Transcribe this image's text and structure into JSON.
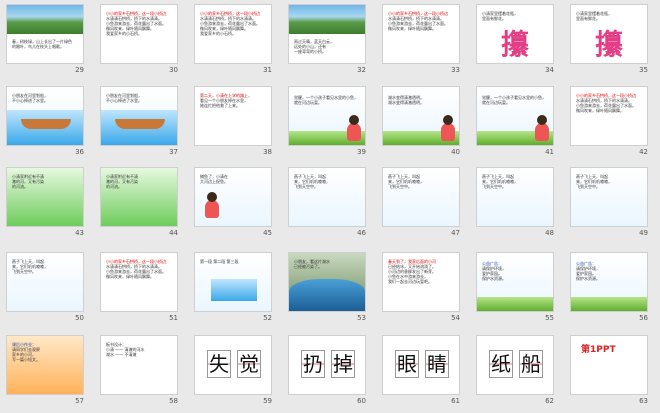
{
  "slides": [
    {
      "number": "29",
      "kind": "photo-text",
      "lines": [
        "春，树枝绿，山上长出了一片绿色",
        "的嫩叶，鸟儿在枝头上唱歌。"
      ]
    },
    {
      "number": "30",
      "kind": "text",
      "lines": [
        "小小的家乡石拱桥，这一段小桥边",
        "水清清石拱桥，桥下的水清清。",
        "小鱼游来游去，荷花露出了水面。",
        "微风吹来，绿叶随风飘舞。",
        "我爱家乡的小石桥。"
      ]
    },
    {
      "number": "31",
      "kind": "text",
      "lines": [
        "小小的家乡石拱桥，这一段小桥边",
        "水清清石拱桥，桥下的水清清。",
        "小鱼游来游去，荷花露出了水面。",
        "微风吹来，绿叶随风飘舞。",
        "我爱家乡的小石桥。"
      ]
    },
    {
      "number": "32",
      "kind": "photo-text",
      "lines": [
        "雨过天晴，蓝天白云，",
        "远处的小山，还有",
        "一座弯弯的小桥。"
      ]
    },
    {
      "number": "33",
      "kind": "text",
      "lines": [
        "小小的家乡石拱桥，这一段小桥边",
        "水清清石拱桥，桥下的水清清。",
        "小鱼游来游去，荷花露出了水面。",
        "微风吹来，绿叶随风飘舞。"
      ]
    },
    {
      "number": "34",
      "kind": "bigchar",
      "lines": [
        "小清家里摆着花瓶，",
        "里面有鲜花。"
      ],
      "char": "攥"
    },
    {
      "number": "35",
      "kind": "bigchar",
      "lines": [
        "小清家里摆着花瓶，",
        "里面有鲜花。"
      ],
      "char": "攥"
    },
    {
      "number": "36",
      "kind": "boat",
      "lines": [
        "小朋友在河里划船，",
        "不小心掉进了水里。"
      ]
    },
    {
      "number": "37",
      "kind": "boat",
      "lines": [
        "小朋友在河里划船，",
        "不小心掉进了水里。"
      ]
    },
    {
      "number": "38",
      "kind": "text",
      "lines": [
        "第二天，小清在上学的路上，",
        "看见一个小朋友掉在水里，",
        "她连忙把他救了上来。"
      ]
    },
    {
      "number": "39",
      "kind": "scene",
      "lines": [
        "觉醒，一个小孩子看见水里的小鱼，",
        "就在河边玩耍。"
      ]
    },
    {
      "number": "40",
      "kind": "scene",
      "lines": [
        "湖水变得清澈透明。",
        "湖水变得清澈透明。"
      ]
    },
    {
      "number": "41",
      "kind": "scene",
      "lines": [
        "觉醒，一个小孩子看见水里的小鱼，",
        "就在河边玩耍。"
      ]
    },
    {
      "number": "42",
      "kind": "text",
      "lines": [
        "小小的家乡石拱桥，这一段小桥边",
        "水清清石拱桥，桥下的水清清。",
        "小鱼游来游去，荷花露出了水面。",
        "微风吹来，绿叶随风飘舞。"
      ]
    },
    {
      "number": "43",
      "kind": "fish",
      "lines": [
        "小清家附近有不清",
        "澈的河，又有污染",
        "的河流。"
      ]
    },
    {
      "number": "44",
      "kind": "fish",
      "lines": [
        "小清家附近有不清",
        "澈的河，又有污染",
        "的河流。"
      ]
    },
    {
      "number": "45",
      "kind": "girl",
      "lines": [
        "捕鱼了，小清在",
        "大河边上捉鱼。"
      ]
    },
    {
      "number": "46",
      "kind": "bird",
      "lines": [
        "燕子飞上天，叫起",
        "来，它们叽叽喳喳，",
        "飞到天空中。"
      ]
    },
    {
      "number": "47",
      "kind": "bird",
      "lines": [
        "燕子飞上天，叫起",
        "来，它们叽叽喳喳，",
        "飞到天空中。"
      ]
    },
    {
      "number": "48",
      "kind": "bird",
      "lines": [
        "燕子飞上天，叫起",
        "来，它们叽叽喳喳，",
        "飞到天空中。"
      ]
    },
    {
      "number": "49",
      "kind": "bird",
      "lines": [
        "燕子飞上天，叫起",
        "来，它们叽叽喳喳，",
        "飞到天空中。"
      ]
    },
    {
      "number": "50",
      "kind": "bird",
      "lines": [
        "燕子飞上天，叫起",
        "来，它们叽叽喳喳，",
        "飞到天空中。"
      ]
    },
    {
      "number": "51",
      "kind": "text",
      "lines": [
        "小小的家乡石拱桥，这一段小桥边",
        "水清清石拱桥，桥下的水清清。",
        "小鱼游来游去，荷花露出了水面。",
        "微风吹来，绿叶随风飘舞。"
      ]
    },
    {
      "number": "52",
      "kind": "boatsmall",
      "lines": [
        "第一段 第二段 第三段"
      ]
    },
    {
      "number": "53",
      "kind": "pond",
      "lines": [
        "小朋友，看这片湖水",
        "已经被污染了。"
      ]
    },
    {
      "number": "54",
      "kind": "text",
      "lines": [
        "春天到了，我家后面的小河",
        "已经结冰，又开始流淌了。",
        "小河边的垂柳发出了新芽。",
        "小鱼在水中游来游去，",
        "我们一起去河边玩耍吧。"
      ]
    },
    {
      "number": "55",
      "kind": "banner",
      "lines": [
        "公益广告：",
        "请保护环境，",
        "爱护家园。",
        "保护水资源。"
      ]
    },
    {
      "number": "56",
      "kind": "banner",
      "lines": [
        "公益广告：",
        "请保护环境，",
        "爱护家园。",
        "保护水资源。"
      ]
    },
    {
      "number": "57",
      "kind": "orange",
      "lines": [
        "课后小作业：",
        "请同学们去观察",
        "家乡的小河，",
        "写一篇小短文。"
      ]
    },
    {
      "number": "58",
      "kind": "plain",
      "lines": [
        "板书设计：",
        "小清 —— 清澈的河水",
        "湖水 —— 不清澈"
      ]
    },
    {
      "number": "59",
      "kind": "chars",
      "chars": [
        "失",
        "觉"
      ]
    },
    {
      "number": "60",
      "kind": "chars",
      "chars": [
        "扔",
        "掉"
      ]
    },
    {
      "number": "61",
      "kind": "chars",
      "chars": [
        "眼",
        "睛"
      ]
    },
    {
      "number": "62",
      "kind": "chars",
      "chars": [
        "纸",
        "船"
      ]
    },
    {
      "number": "63",
      "kind": "ppt",
      "logo": "第1PPT"
    }
  ]
}
